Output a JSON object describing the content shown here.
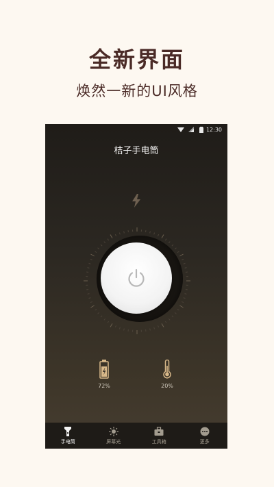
{
  "promo": {
    "title": "全新界面",
    "subtitle": "焕然一新的UI风格"
  },
  "statusbar": {
    "time": "12:30",
    "icons": [
      "wifi-icon",
      "signal-icon",
      "battery-icon"
    ]
  },
  "app": {
    "title": "桔子手电筒"
  },
  "flash": {
    "icon": "lightning-icon"
  },
  "power_button": {
    "icon": "power-icon"
  },
  "stats": {
    "battery": {
      "icon": "battery-level-icon",
      "value": "72%"
    },
    "temperature": {
      "icon": "thermometer-icon",
      "value": "20%"
    }
  },
  "nav": {
    "items": [
      {
        "label": "手电筒",
        "icon": "flashlight-icon",
        "active": true
      },
      {
        "label": "屏幕光",
        "icon": "sun-icon",
        "active": false
      },
      {
        "label": "工具箱",
        "icon": "toolbox-icon",
        "active": false
      },
      {
        "label": "更多",
        "icon": "more-icon",
        "active": false
      }
    ]
  },
  "colors": {
    "background": "#fdf8f1",
    "promo_text": "#4a2a26",
    "accent": "#d9b98a"
  }
}
